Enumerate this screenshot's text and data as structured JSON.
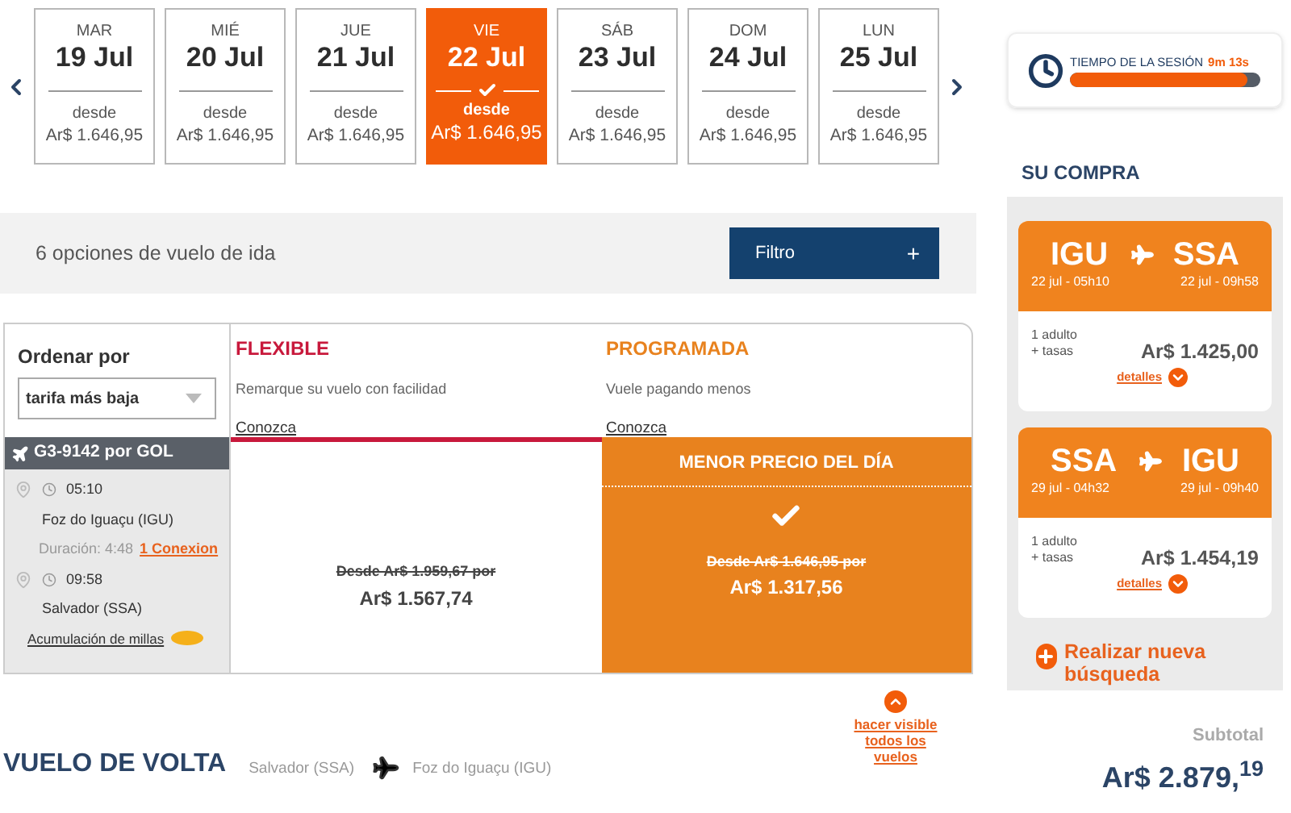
{
  "dates": [
    {
      "weekday": "MAR",
      "date": "19 Jul",
      "from_label": "desde",
      "price": "Ar$ 1.646,95",
      "selected": false
    },
    {
      "weekday": "MIÉ",
      "date": "20 Jul",
      "from_label": "desde",
      "price": "Ar$ 1.646,95",
      "selected": false
    },
    {
      "weekday": "JUE",
      "date": "21 Jul",
      "from_label": "desde",
      "price": "Ar$ 1.646,95",
      "selected": false
    },
    {
      "weekday": "VIE",
      "date": "22 Jul",
      "from_label": "desde",
      "price": "Ar$ 1.646,95",
      "selected": true
    },
    {
      "weekday": "SÁB",
      "date": "23 Jul",
      "from_label": "desde",
      "price": "Ar$ 1.646,95",
      "selected": false
    },
    {
      "weekday": "DOM",
      "date": "24 Jul",
      "from_label": "desde",
      "price": "Ar$ 1.646,95",
      "selected": false
    },
    {
      "weekday": "LUN",
      "date": "25 Jul",
      "from_label": "desde",
      "price": "Ar$ 1.646,95",
      "selected": false
    }
  ],
  "filter": {
    "count_text": "6 opciones de vuelo de ida",
    "button_label": "Filtro",
    "button_icon": "+"
  },
  "sort": {
    "label": "Ordenar por",
    "value": "tarifa más baja"
  },
  "flight": {
    "code": "G3-9142 por  GOL",
    "departure_time": "05:10",
    "origin": "Foz do Iguaçu (IGU)",
    "duration": "Duración: 4:48",
    "connections": "1 Conexion",
    "arrival_time": "09:58",
    "destination": "Salvador (SSA)",
    "miles_link": "Acumulación de millas"
  },
  "fares": [
    {
      "title": "FLEXIBLE",
      "subtitle": "Remarque su vuelo con facilidad",
      "link": "Conozca",
      "color": "#c8193c",
      "original_price": "Desde  Ar$ 1.959,67 por",
      "price": "Ar$ 1.567,74",
      "selected": false
    },
    {
      "title": "PROGRAMADA",
      "subtitle": "Vuele pagando menos",
      "link": "Conozca",
      "color": "#e8821e",
      "banner": "MENOR  PRECIO DEL DÍA",
      "original_price": "Desde  Ar$ 1.646,95 por",
      "price": "Ar$ 1.317,56",
      "selected": true
    }
  ],
  "show_all_link": "hacer visible todos los vuelos",
  "return_flight": {
    "title": "VUELO DE VOLTA",
    "origin": "Salvador  (SSA)",
    "destination": "Foz do Iguaçu  (IGU)"
  },
  "session": {
    "label": "TIEMPO DE LA SESIÓN",
    "remaining": "9m 13s",
    "level": 0.93
  },
  "purchase": {
    "title": "SU COMPRA",
    "segments": [
      {
        "from": "IGU",
        "to": "SSA",
        "from_time": "22 jul - 05h10",
        "to_time": "22 jul - 09h58",
        "passengers": "1 adulto",
        "taxes": "+ tasas",
        "price": "Ar$ 1.425,00",
        "details_link": "detalles"
      },
      {
        "from": "SSA",
        "to": "IGU",
        "from_time": "29 jul - 04h32",
        "to_time": "29 jul - 09h40",
        "passengers": "1 adulto",
        "taxes": "+ tasas",
        "price": "Ar$ 1.454,19",
        "details_link": "detalles"
      }
    ],
    "new_search": "Realizar nueva búsqueda",
    "subtotal_label": "Subtotal",
    "subtotal": "Ar$ 2.879,$^{19}$"
  }
}
